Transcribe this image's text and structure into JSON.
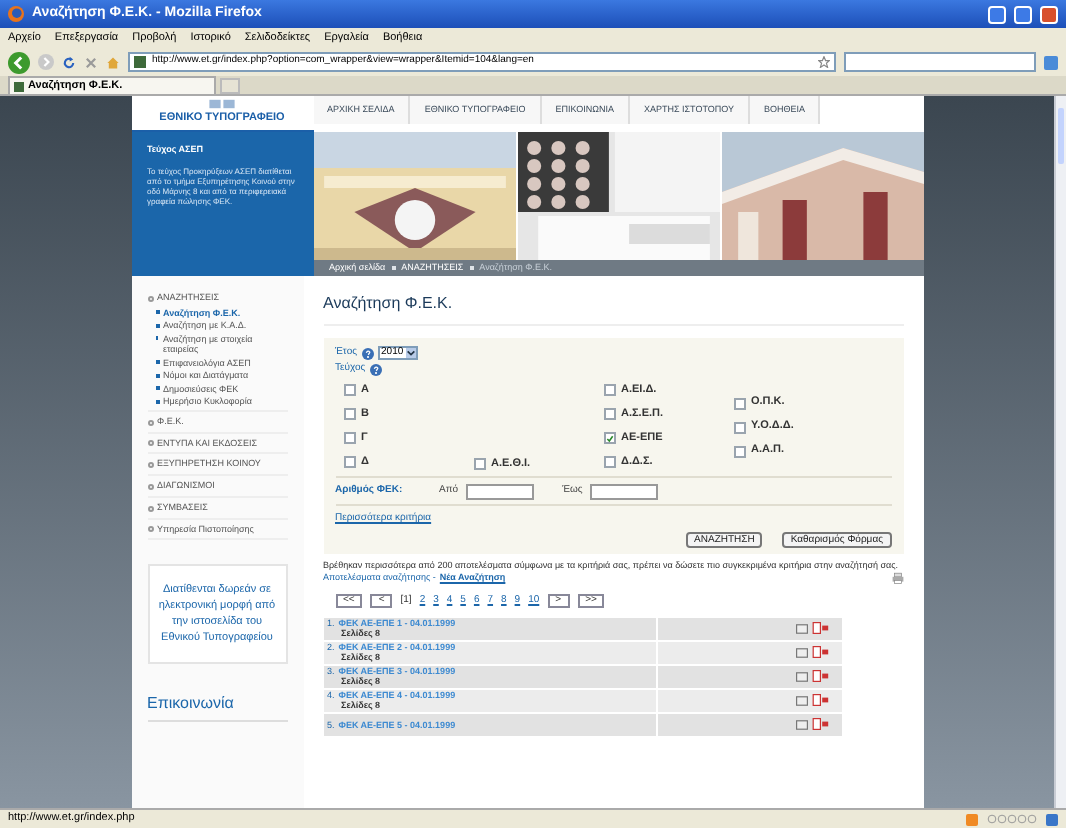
{
  "window": {
    "title": "Αναζήτηση Φ.Ε.Κ. - Mozilla Firefox"
  },
  "menu": [
    "Αρχείο",
    "Επεξεργασία",
    "Προβολή",
    "Ιστορικό",
    "Σελιδοδείκτες",
    "Εργαλεία",
    "Βοήθεια"
  ],
  "address": {
    "value": "http://www.et.gr/index.php?option=com_wrapper&view=wrapper&Itemid=104&lang=en"
  },
  "tabs": [
    {
      "label": "Αναζήτηση Φ.Ε.Κ.",
      "selected": true
    }
  ],
  "site": {
    "logo": "ΕΘΝΙΚΟ ΤΥΠΟΓΡΑΦΕΙΟ",
    "nav": [
      "ΑΡΧΙΚΗ ΣΕΛΙΔΑ",
      "ΕΘΝΙΚΟ ΤΥΠΟΓΡΑΦΕΙΟ",
      "ΕΠΙΚΟΙΝΩΝΙΑ",
      "ΧΑΡΤΗΣ ΙΣΤΟΤΟΠΟΥ",
      "ΒΟΗΘΕΙΑ"
    ],
    "promo": {
      "title": "Τεύχος ΑΣΕΠ",
      "text": "Το τεύχος Προκηρύξεων ΑΣΕΠ διατίθεται από το τμήμα Εξυπηρέτησης Κοινού στην οδό Μάρνης 8 και από τα περιφερειακά γραφεία πώλησης ΦΕΚ."
    },
    "breadcrumb": [
      "Αρχική σελίδα",
      "ΑΝΑΖΗΤΗΣΕΙΣ",
      "Αναζήτηση Φ.Ε.Κ."
    ]
  },
  "sidebar": {
    "items": [
      {
        "label": "ΑΝΑΖΗΤΗΣΕΙΣ",
        "children": [
          {
            "label": "Αναζήτηση Φ.Ε.Κ.",
            "selected": true
          },
          {
            "label": "Αναζήτηση με Κ.Α.Δ.",
            "selected": false
          },
          {
            "label": "Αναζήτηση με στοιχεία εταιρείας",
            "selected": false
          },
          {
            "label": "Επιφανειολόγια ΑΣΕΠ",
            "selected": false
          },
          {
            "label": "Νόμοι και Διατάγματα",
            "selected": false
          },
          {
            "label": "Δημοσιεύσεις ΦΕΚ",
            "selected": false
          },
          {
            "label": "Ημερήσιο Κυκλοφορία",
            "selected": false
          }
        ]
      },
      {
        "label": "Φ.Ε.Κ."
      },
      {
        "label": "ΕΝΤΥΠΑ ΚΑΙ ΕΚΔΟΣΕΙΣ"
      },
      {
        "label": "ΕΞΥΠΗΡΕΤΗΣΗ ΚΟΙΝΟΥ"
      },
      {
        "label": "ΔΙΑΓΩΝΙΣΜΟΙ"
      },
      {
        "label": "ΣΥΜΒΑΣΕΙΣ"
      },
      {
        "label": "Υπηρεσία Πιστοποίησης"
      }
    ],
    "notice": "Διατίθενται δωρεάν σε ηλεκτρονική μορφή από την ιστοσελίδα του Εθνικού Τυπογραφείου",
    "contact": "Επικοινωνία"
  },
  "main": {
    "title": "Αναζήτηση Φ.Ε.Κ.",
    "year": {
      "label": "Έτος",
      "value": "2010"
    },
    "issue_label": "Τεύχος",
    "issue_columns": [
      {
        "kind": "top",
        "items": [
          {
            "label": "Α",
            "checked": false
          },
          {
            "label": "Β",
            "checked": false
          },
          {
            "label": "Γ",
            "checked": false
          },
          {
            "label": "Δ",
            "checked": false
          }
        ]
      },
      {
        "kind": "bottom",
        "items": [
          {
            "label": "Α.Ε.Θ.Ι.",
            "checked": false
          }
        ]
      },
      {
        "kind": "top",
        "items": [
          {
            "label": "Α.ΕΙ.Δ.",
            "checked": false
          },
          {
            "label": "Α.Σ.Ε.Π.",
            "checked": false
          },
          {
            "label": "ΑΕ-ΕΠΕ",
            "checked": true
          },
          {
            "label": "Δ.Δ.Σ.",
            "checked": false
          }
        ]
      },
      {
        "kind": "middle",
        "items": [
          {
            "label": "Ο.Π.Κ.",
            "checked": false
          },
          {
            "label": "Υ.Ο.Δ.Δ.",
            "checked": false
          },
          {
            "label": "Α.Α.Π.",
            "checked": false
          }
        ]
      }
    ],
    "number": {
      "label": "Αριθμός ΦΕΚ:",
      "from": "Από",
      "to": "Έως"
    },
    "more_link": "Περισσότερα κριτήρια",
    "buttons": [
      "ΑΝΑΖΗΤΗΣΗ",
      "Καθαρισμός Φόρμας"
    ],
    "message": "Βρέθηκαν περισσότερα από 200 αποτελέσματα σύμφωνα με τα κριτήριά σας, πρέπει να δώσετε πιο συγκεκριμένα κριτήρια στην αναζήτησή σας.",
    "results_label": "Αποτελέσματα αναζήτησης -",
    "new_search": "Νέα Αναζήτηση",
    "pager": {
      "first": "<<",
      "prev": "<",
      "pages": [
        {
          "label": "[1]",
          "selected": true
        },
        {
          "label": "2",
          "selected": false
        },
        {
          "label": "3",
          "selected": false
        },
        {
          "label": "4",
          "selected": false
        },
        {
          "label": "5",
          "selected": false
        },
        {
          "label": "6",
          "selected": false
        },
        {
          "label": "7",
          "selected": false
        },
        {
          "label": "8",
          "selected": false
        },
        {
          "label": "9",
          "selected": false
        },
        {
          "label": "10",
          "selected": false
        }
      ],
      "next": ">",
      "last": ">>"
    },
    "results": [
      {
        "number": "1.",
        "title": "ΦΕΚ ΑΕ-ΕΠΕ 1 - 04.01.1999",
        "pages": "Σελίδες 8"
      },
      {
        "number": "2.",
        "title": "ΦΕΚ ΑΕ-ΕΠΕ 2 - 04.01.1999",
        "pages": "Σελίδες 8"
      },
      {
        "number": "3.",
        "title": "ΦΕΚ ΑΕ-ΕΠΕ 3 - 04.01.1999",
        "pages": "Σελίδες 8"
      },
      {
        "number": "4.",
        "title": "ΦΕΚ ΑΕ-ΕΠΕ 4 - 04.01.1999",
        "pages": "Σελίδες 8"
      },
      {
        "number": "5.",
        "title": "ΦΕΚ ΑΕ-ΕΠΕ 5 - 04.01.1999"
      }
    ]
  },
  "status_bar": "http://www.et.gr/index.php"
}
